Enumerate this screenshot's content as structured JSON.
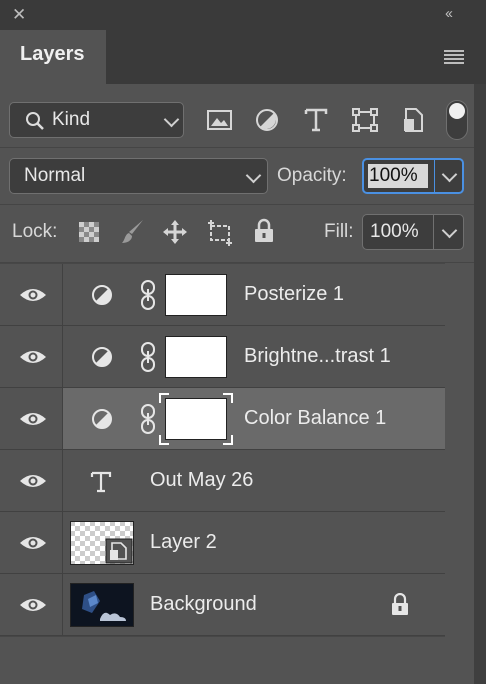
{
  "panel": {
    "title": "Layers"
  },
  "filter": {
    "kind_label": "Kind"
  },
  "blend": {
    "mode": "Normal",
    "opacity_label": "Opacity:",
    "opacity_value": "100%"
  },
  "lock": {
    "label": "Lock:",
    "fill_label": "Fill:",
    "fill_value": "100%"
  },
  "layers": [
    {
      "name": "Posterize 1",
      "type": "adjustment",
      "visible": true,
      "selected": false
    },
    {
      "name": "Brightne...trast 1",
      "type": "adjustment",
      "visible": true,
      "selected": false
    },
    {
      "name": "Color Balance 1",
      "type": "adjustment",
      "visible": true,
      "selected": true
    },
    {
      "name": "Out May 26",
      "type": "text",
      "visible": true,
      "selected": false
    },
    {
      "name": "Layer 2",
      "type": "smart-object",
      "visible": true,
      "selected": false
    },
    {
      "name": "Background",
      "type": "image",
      "visible": true,
      "selected": false,
      "locked": true
    }
  ],
  "colors": {
    "panel_bg": "#535353",
    "selected_row": "#6a6a6a",
    "focus_ring": "#4a90e2"
  }
}
